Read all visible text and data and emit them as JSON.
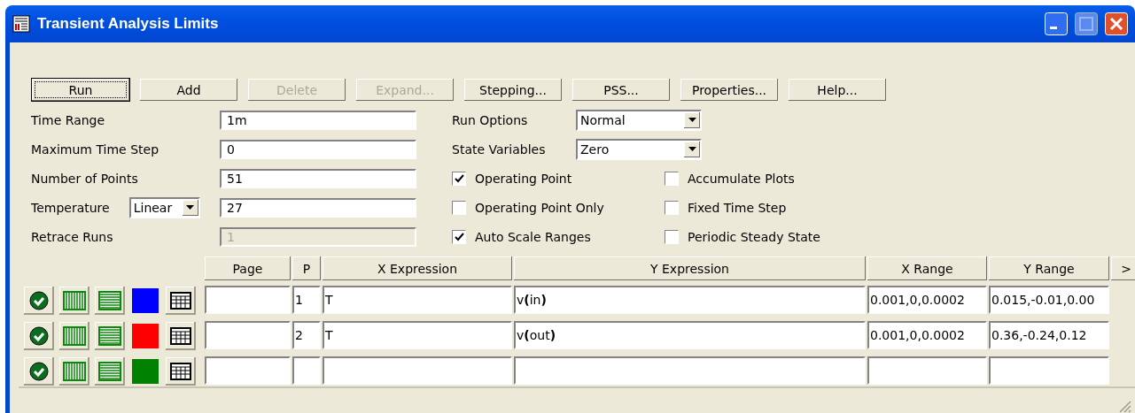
{
  "window": {
    "title": "Transient Analysis Limits"
  },
  "toolbar": [
    {
      "label": "Run",
      "default": true,
      "disabled": false
    },
    {
      "label": "Add",
      "default": false,
      "disabled": false
    },
    {
      "label": "Delete",
      "default": false,
      "disabled": true
    },
    {
      "label": "Expand...",
      "default": false,
      "disabled": true
    },
    {
      "label": "Stepping...",
      "default": false,
      "disabled": false
    },
    {
      "label": "PSS...",
      "default": false,
      "disabled": false
    },
    {
      "label": "Properties...",
      "default": false,
      "disabled": false
    },
    {
      "label": "Help...",
      "default": false,
      "disabled": false
    }
  ],
  "fields": [
    {
      "label": "Time Range",
      "value": "1m",
      "disabled": false
    },
    {
      "label": "Maximum Time Step",
      "value": "0",
      "disabled": false
    },
    {
      "label": "Number of Points",
      "value": "51",
      "disabled": false
    },
    {
      "label": "Temperature",
      "mode": "Linear",
      "value": "27",
      "disabled": false
    },
    {
      "label": "Retrace Runs",
      "value": "1",
      "disabled": true
    }
  ],
  "options": [
    {
      "label": "Run Options",
      "value": "Normal"
    },
    {
      "label": "State Variables",
      "value": "Zero"
    }
  ],
  "checkboxes": [
    {
      "label": "Operating Point",
      "checked": true
    },
    {
      "label": "Accumulate Plots",
      "checked": false
    },
    {
      "label": "Operating Point Only",
      "checked": false
    },
    {
      "label": "Fixed Time Step",
      "checked": false
    },
    {
      "label": "Auto Scale Ranges",
      "checked": true
    },
    {
      "label": "Periodic Steady State",
      "checked": false
    }
  ],
  "grid": {
    "columns": [
      "Page",
      "P",
      "X Expression",
      "Y Expression",
      "X Range",
      "Y Range"
    ],
    "more_button": ">",
    "rows": [
      {
        "enabled": true,
        "color": "#0000ff",
        "p": "1",
        "x_expression": "T",
        "y_expression": "v**(**in**)**",
        "x_range": "0.001,0,0.0002",
        "y_range": "0.015,-0.01,0.00"
      },
      {
        "enabled": true,
        "color": "#ff0000",
        "p": "2",
        "x_expression": "T",
        "y_expression": "v**(**out**)**",
        "x_range": "0.001,0,0.0002",
        "y_range": "0.36,-0.24,0.12"
      },
      {
        "enabled": true,
        "color": "#008000"
      }
    ]
  }
}
